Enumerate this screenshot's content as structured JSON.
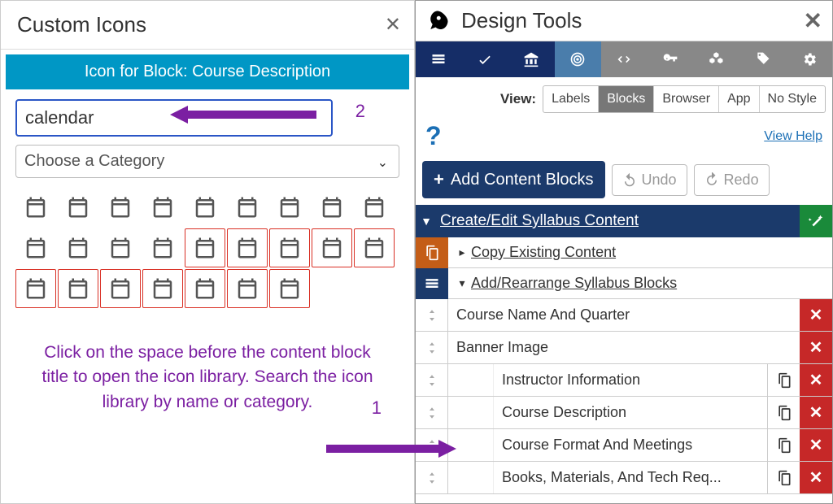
{
  "left": {
    "title": "Custom Icons",
    "bar": "Icon for Block: Course Description",
    "search_value": "calendar",
    "category_placeholder": "Choose a Category",
    "annotation2": "2",
    "annotation1": "1",
    "instructions": "Click on the space before the content block title to open the icon library. Search the icon library by name or category.",
    "icons": [
      {
        "name": "calendar-solid",
        "hl": false
      },
      {
        "name": "calendar-outline",
        "hl": false
      },
      {
        "name": "calendar-alt",
        "hl": false
      },
      {
        "name": "calendar-alt-outline",
        "hl": false
      },
      {
        "name": "calendar-check-solid",
        "hl": false
      },
      {
        "name": "calendar-check-outline",
        "hl": false
      },
      {
        "name": "calendar-day",
        "hl": false
      },
      {
        "name": "calendar-days",
        "hl": false
      },
      {
        "name": "calendar-grid",
        "hl": false
      },
      {
        "name": "calendar-minus",
        "hl": false
      },
      {
        "name": "calendar-plus-solid",
        "hl": false
      },
      {
        "name": "calendar-x-solid",
        "hl": false
      },
      {
        "name": "calendar-x-outline",
        "hl": false
      },
      {
        "name": "calendar-add-outline",
        "hl": true
      },
      {
        "name": "calendar-add2",
        "hl": true
      },
      {
        "name": "calendar-clock",
        "hl": true
      },
      {
        "name": "calendar-clock2",
        "hl": true
      },
      {
        "name": "calendar-3-outline",
        "hl": true
      },
      {
        "name": "calendar-3-solid",
        "hl": true
      },
      {
        "name": "calendar-3-alt",
        "hl": true
      },
      {
        "name": "calendar-week",
        "hl": true
      },
      {
        "name": "calendar-grid2",
        "hl": true
      },
      {
        "name": "calendar-grid3",
        "hl": true
      },
      {
        "name": "calendar-check2",
        "hl": true
      },
      {
        "name": "calendar-check3",
        "hl": true
      }
    ]
  },
  "right": {
    "title": "Design Tools",
    "tools": [
      {
        "name": "list",
        "variant": "navy"
      },
      {
        "name": "check",
        "variant": "navy"
      },
      {
        "name": "bank",
        "variant": "navy"
      },
      {
        "name": "target",
        "variant": "blue"
      },
      {
        "name": "code",
        "variant": "gray"
      },
      {
        "name": "key",
        "variant": "gray"
      },
      {
        "name": "cubes",
        "variant": "gray"
      },
      {
        "name": "tag",
        "variant": "gray"
      },
      {
        "name": "gears",
        "variant": "gray"
      }
    ],
    "view_label": "View:",
    "view_options": [
      "Labels",
      "Blocks",
      "Browser",
      "App",
      "No Style"
    ],
    "view_selected": "Blocks",
    "help_link": "View Help",
    "add_button": "Add Content Blocks",
    "undo": "Undo",
    "redo": "Redo",
    "section": "Create/Edit Syllabus Content",
    "copy_section": "Copy Existing Content",
    "rearrange_section": "Add/Rearrange Syllabus Blocks",
    "blocks": [
      {
        "label": "Course Name And Quarter",
        "copy": false
      },
      {
        "label": "Banner Image",
        "copy": false
      },
      {
        "label": "Instructor Information",
        "copy": true
      },
      {
        "label": "Course Description",
        "copy": true
      },
      {
        "label": "Course Format And Meetings",
        "copy": true
      },
      {
        "label": "Books, Materials, And Tech Req...",
        "copy": true
      }
    ]
  }
}
